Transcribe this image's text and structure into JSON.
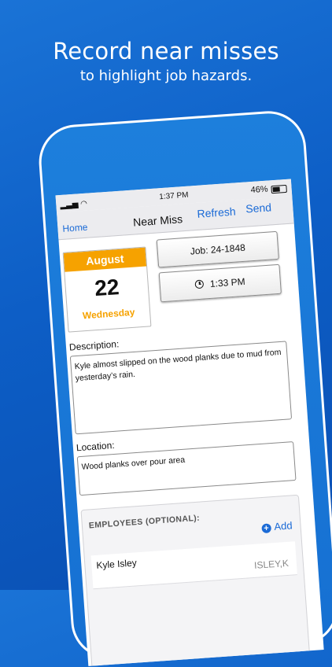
{
  "headline": "Record near misses",
  "subline": "to highlight job hazards.",
  "status_bar": {
    "time": "1:37 PM",
    "battery": "46%"
  },
  "nav": {
    "back": "Home",
    "title": "Near Miss",
    "refresh": "Refresh",
    "send": "Send"
  },
  "calendar": {
    "month": "August",
    "day": "22",
    "weekday": "Wednesday"
  },
  "job_button": "Job: 24-1848",
  "time_button": "1:33 PM",
  "description": {
    "label": "Description:",
    "value": "Kyle almost slipped on the wood planks due to mud from yesterday’s rain."
  },
  "location": {
    "label": "Location:",
    "value": "Wood planks over pour area"
  },
  "employees": {
    "header": "EMPLOYEES (OPTIONAL):",
    "add_label": "Add",
    "rows": [
      {
        "name": "Kyle Isley",
        "code": "ISLEY,K"
      }
    ]
  },
  "colors": {
    "background": "#0d5ec6",
    "accent": "#1a6ad6",
    "calendar_orange": "#f6a200"
  }
}
